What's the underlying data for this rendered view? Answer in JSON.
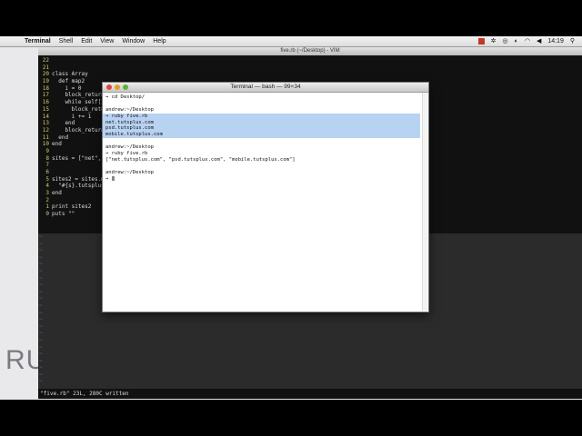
{
  "menubar": {
    "apple_symbol": "",
    "items": [
      "Terminal",
      "Shell",
      "Edit",
      "View",
      "Window",
      "Help"
    ],
    "clock": "14:19"
  },
  "desktop": {
    "background_text": "RU"
  },
  "vim": {
    "title": "five.rb (~/Desktop) - VIM",
    "status": "\"five.rb\" 23L, 280C written",
    "tilde_rows": 22,
    "code_lines": [
      {
        "n": "22",
        "t": ""
      },
      {
        "n": "21",
        "t": ""
      },
      {
        "n": "20",
        "t": "class Array"
      },
      {
        "n": "19",
        "t": "  def map2"
      },
      {
        "n": "18",
        "t": "    i = 0"
      },
      {
        "n": "17",
        "t": "    block_return"
      },
      {
        "n": "16",
        "t": "    while self[i"
      },
      {
        "n": "15",
        "t": "      block_retu"
      },
      {
        "n": "14",
        "t": "      i += 1"
      },
      {
        "n": "13",
        "t": "    end"
      },
      {
        "n": "12",
        "t": "    block_return"
      },
      {
        "n": "11",
        "t": "  end"
      },
      {
        "n": "10",
        "t": "end"
      },
      {
        "n": "9",
        "t": ""
      },
      {
        "n": "8",
        "t": "sites = [\"net\","
      },
      {
        "n": "7",
        "t": ""
      },
      {
        "n": "6",
        "t": ""
      },
      {
        "n": "5",
        "t": "sites2 = sites.m"
      },
      {
        "n": "4",
        "t": "  \"#{s}.tutsplus"
      },
      {
        "n": "3",
        "t": "end"
      },
      {
        "n": "2",
        "t": ""
      },
      {
        "n": "1",
        "t": "print sites2"
      },
      {
        "n": "0",
        "t": "puts \"\""
      }
    ]
  },
  "terminal": {
    "title": "Terminal — bash — 99×34",
    "lines": [
      {
        "t": "→ cd Desktop/",
        "hl": false
      },
      {
        "t": "",
        "hl": false
      },
      {
        "t": "andrew:~/Desktop",
        "hl": false
      },
      {
        "t": "→ ruby five.rb",
        "hl": true
      },
      {
        "t": "net.tutsplus.com",
        "hl": true
      },
      {
        "t": "psd.tutsplus.com",
        "hl": true
      },
      {
        "t": "mobile.tutsplus.com",
        "hl": true
      },
      {
        "t": "",
        "hl": false
      },
      {
        "t": "andrew:~/Desktop",
        "hl": false
      },
      {
        "t": "→ ruby five.rb",
        "hl": false
      },
      {
        "t": "[\"net.tutsplus.com\", \"psd.tutsplus.com\", \"mobile.tutsplus.com\"]",
        "hl": false
      },
      {
        "t": "",
        "hl": false
      },
      {
        "t": "andrew:~/Desktop",
        "hl": false
      },
      {
        "t": "→ ",
        "hl": false,
        "cursor": true
      }
    ]
  },
  "colors": {
    "selection": "#b8d2f1",
    "line_numbers": "#cfcf6a",
    "traffic_red": "#e0443e",
    "traffic_yellow": "#dea123",
    "traffic_green": "#5bb33b"
  }
}
